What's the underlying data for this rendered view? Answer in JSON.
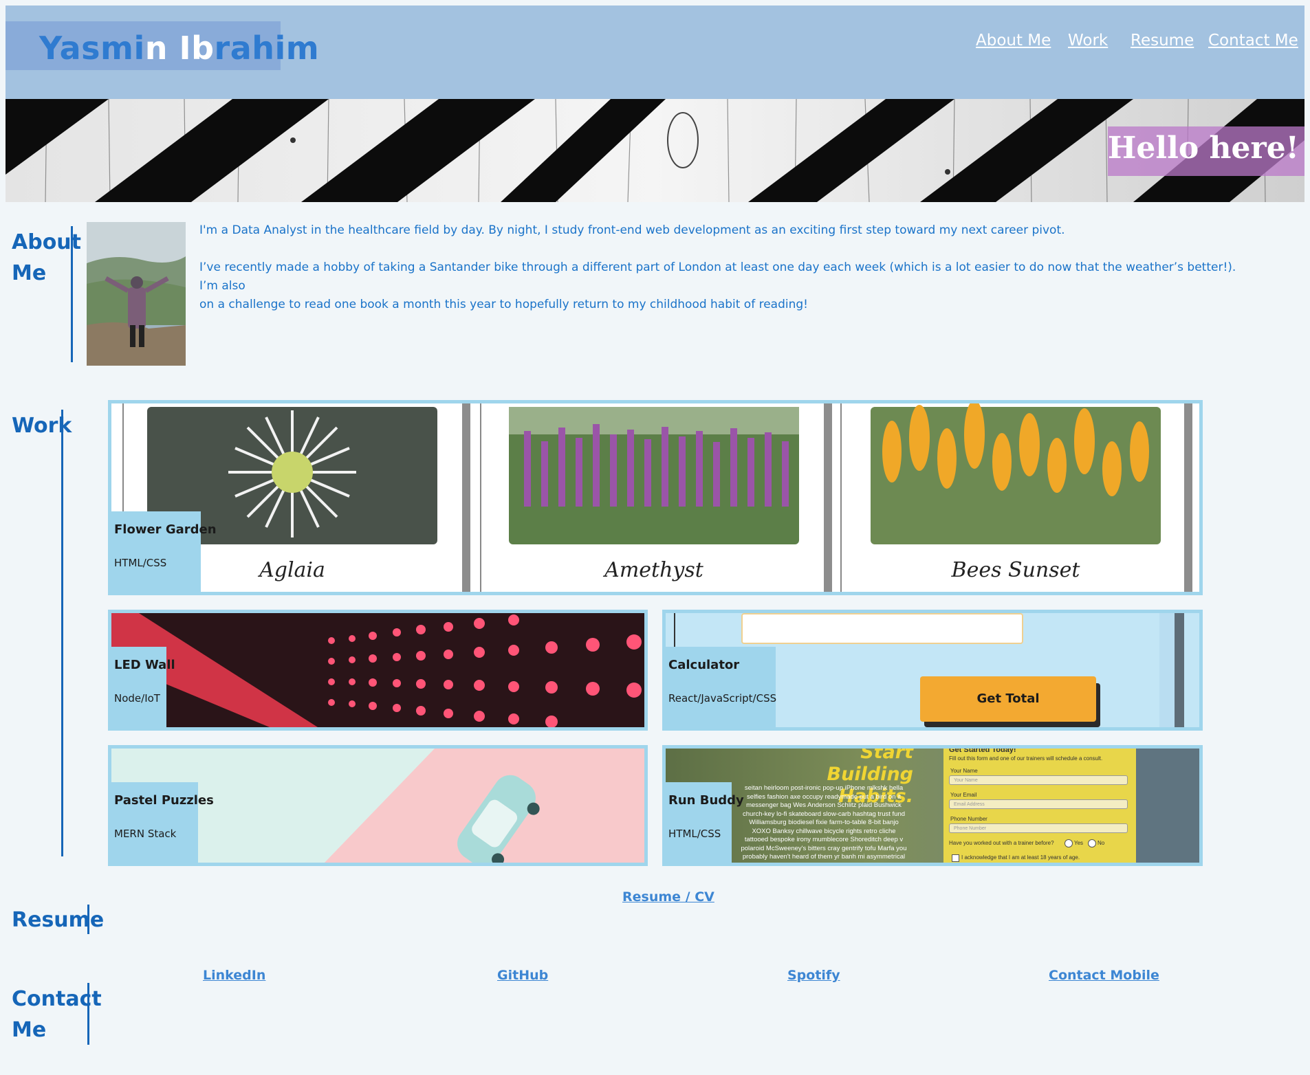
{
  "header": {
    "brand_part1": "Yasmi",
    "brand_part2": "n Ib",
    "brand_part3": "rahim",
    "nav": [
      "About Me",
      "Work",
      "Resume",
      "Contact Me"
    ]
  },
  "hero": {
    "text": "Hello here!"
  },
  "about": {
    "heading_line1": "About",
    "heading_line2": "Me",
    "paragraph1": "I'm a Data Analyst in the healthcare field by day. By night, I study front-end web development as an exciting first step toward my next career pivot.",
    "paragraph2_line1": "I’ve recently made a hobby of taking a Santander bike through a different part of London at least one day each week (which is a lot easier to do now that the weather’s better!). I’m also",
    "paragraph2_line2": "on a challenge to read one book a month this year to hopefully return to my childhood habit of reading!"
  },
  "work": {
    "heading": "Work",
    "projects": [
      {
        "title": "Flower Garden",
        "stack": "HTML/CSS",
        "flowers": [
          "Aglaia",
          "Amethyst",
          "Bees Sunset"
        ]
      },
      {
        "title": "LED Wall",
        "stack": "Node/IoT"
      },
      {
        "title": "Calculator",
        "stack": "React/JavaScript/CSS",
        "button": "Get Total"
      },
      {
        "title": "Pastel Puzzles",
        "stack": "MERN Stack"
      },
      {
        "title": "Run Buddy",
        "stack": "HTML/CSS",
        "preview": {
          "headline1": "Start Building",
          "headline2": "Habits.",
          "lorem": [
            "seitan heirloom post-ironic pop-up iPhone mlkshk hella",
            "selfies fashion axe occupy readymade put a bird on it",
            "messenger bag Wes Anderson Schlitz plaid Bushwick",
            "church-key lo-fi skateboard slow-carb hashtag trust fund",
            "Williamsburg biodiesel fixie farm-to-table 8-bit banjo",
            "XOXO Banksy chillwave bicycle rights retro cliche",
            "tattooed bespoke irony mumblecore Shoreditch deep v",
            "polaroid McSweeney's bitters cray gentrify tofu Marfa you",
            "probably haven't heard of them yr banh mi asymmetrical"
          ],
          "form_title": "Get Started Today!",
          "form_sub": "Fill out this form and one of our trainers will schedule a consult.",
          "field1_label": "Your Name",
          "field1_ph": "Your Name",
          "field2_label": "Your Email",
          "field2_ph": "Email Address",
          "field3_label": "Phone Number",
          "field3_ph": "Phone Number",
          "question": "Have you worked out with a trainer before?",
          "yes": "Yes",
          "no": "No",
          "ack": "I acknowledge that I am at least 18 years of age."
        }
      }
    ]
  },
  "resume": {
    "heading": "Resume",
    "link": "Resume / CV"
  },
  "contact": {
    "heading_line1": "Contact",
    "heading_line2": "Me",
    "links": [
      "LinkedIn",
      "GitHub",
      "Spotify",
      "Contact Mobile"
    ]
  },
  "colors": {
    "header_bg": "#a3c2e0",
    "accent": "#1666b8",
    "card_border": "#9fd5ec",
    "page_bg": "#f1f6f9"
  }
}
